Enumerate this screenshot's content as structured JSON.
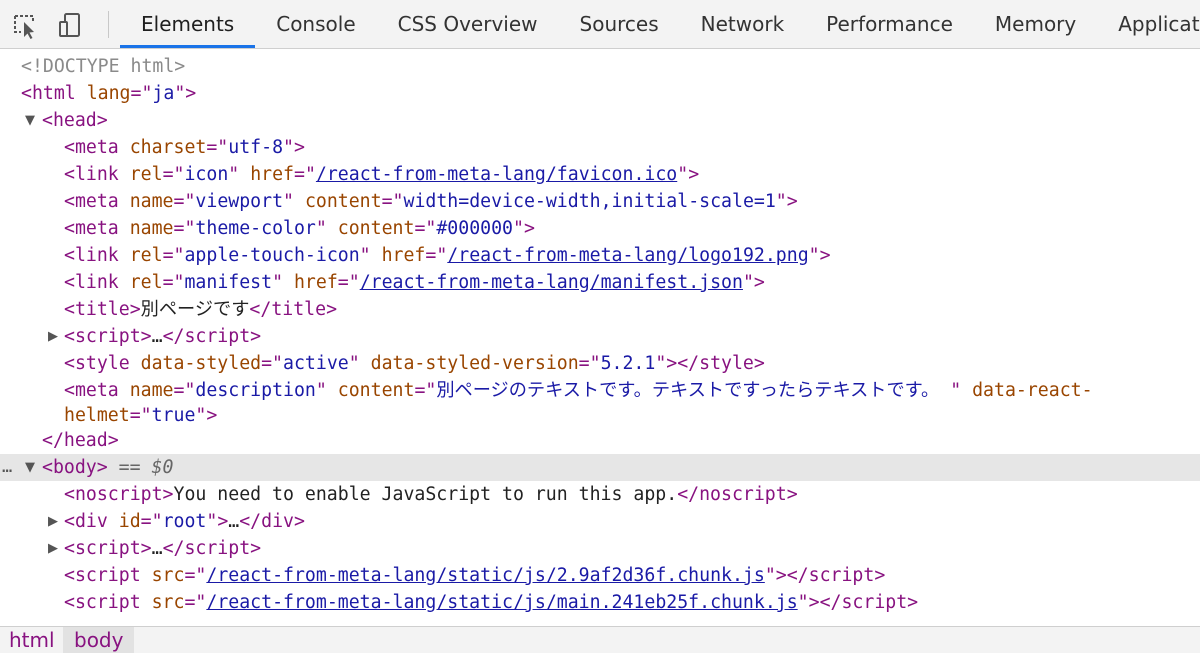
{
  "toolbar": {
    "tools": [
      "inspect-element-icon",
      "device-toolbar-icon"
    ],
    "tabs": [
      "Elements",
      "Console",
      "CSS Overview",
      "Sources",
      "Network",
      "Performance",
      "Memory",
      "Application"
    ],
    "active_tab": "Elements"
  },
  "dom": {
    "doctype": "<!DOCTYPE html>",
    "html_lang": "ja",
    "meta_charset": "utf-8",
    "favicon_href": "/react-from-meta-lang/favicon.ico",
    "viewport_content": "width=device-width,initial-scale=1",
    "theme_color": "#000000",
    "apple_touch_href": "/react-from-meta-lang/logo192.png",
    "manifest_href": "/react-from-meta-lang/manifest.json",
    "title_text": "別ページです",
    "ellipsis": "…",
    "style_data_styled": "active",
    "style_version": "5.2.1",
    "description_content": "別ページのテキストです。テキストですったらテキストです。 ",
    "helmet_value": "true",
    "selected_marker": "== $0",
    "noscript_text": "You need to enable JavaScript to run this app.",
    "root_id": "root",
    "chunk_src": "/react-from-meta-lang/static/js/2.9af2d36f.chunk.js",
    "main_src": "/react-from-meta-lang/static/js/main.241eb25f.chunk.js"
  },
  "breadcrumbs": [
    "html",
    "body"
  ],
  "active_breadcrumb": "body"
}
